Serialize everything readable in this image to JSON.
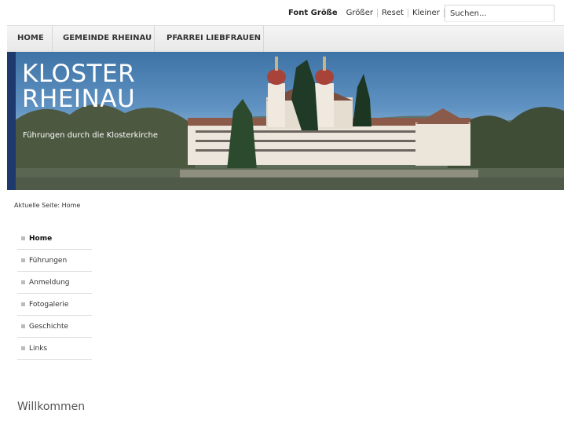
{
  "font_size_widget": {
    "label": "Font Größe",
    "options": [
      "Größer",
      "Reset",
      "Kleiner"
    ]
  },
  "search": {
    "placeholder": "Suchen..."
  },
  "nav": {
    "items": [
      "HOME",
      "GEMEINDE RHEINAU",
      "PFARREI LIEBFRAUEN"
    ]
  },
  "header": {
    "title_line1": "KLOSTER",
    "title_line2": "RHEINAU",
    "subtitle": "Führungen durch die Klosterkirche"
  },
  "breadcrumb": "Aktuelle Seite: Home",
  "sidemenu": {
    "items": [
      "Home",
      "Führungen",
      "Anmeldung",
      "Fotogalerie",
      "Geschichte",
      "Links"
    ],
    "active": "Home"
  },
  "content": {
    "heading": "Willkommen"
  },
  "colors": {
    "accent_strip": "#1e3a6d",
    "sky": "#4a80b4",
    "nav_bg": "#eeeeee"
  }
}
